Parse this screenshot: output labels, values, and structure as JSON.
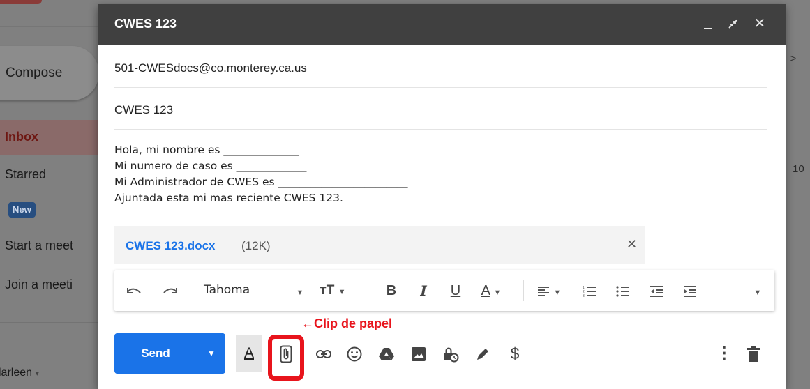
{
  "background": {
    "compose_label": "Compose",
    "nav": {
      "inbox": "Inbox",
      "starred": "Starred",
      "new_badge": "New",
      "start_meeting": "Start a meet",
      "join_meeting": "Join a meeti"
    },
    "user": "larleen",
    "right_number": "10"
  },
  "compose": {
    "title": "CWES 123",
    "to": "501-CWESdocs@co.monterey.ca.us",
    "subject": "CWES 123",
    "body_lines": [
      "Hola, mi nombre es ______________",
      "Mi numero de caso es _____________",
      "Mi Administrador de CWES es ________________________",
      "Ajuntada esta mi mas reciente CWES 123."
    ],
    "attachment": {
      "name": "CWES 123.docx",
      "size": "(12K)"
    },
    "toolbar": {
      "font": "Tahoma"
    },
    "send_label": "Send",
    "text_format_glyph": "A",
    "money_glyph": "$"
  },
  "annotation": {
    "label": "←Clip de papel",
    "color": "#e8141c"
  },
  "colors": {
    "send_button": "#1a73e8",
    "titlebar": "#404040",
    "attachment_link": "#1a73e8"
  }
}
